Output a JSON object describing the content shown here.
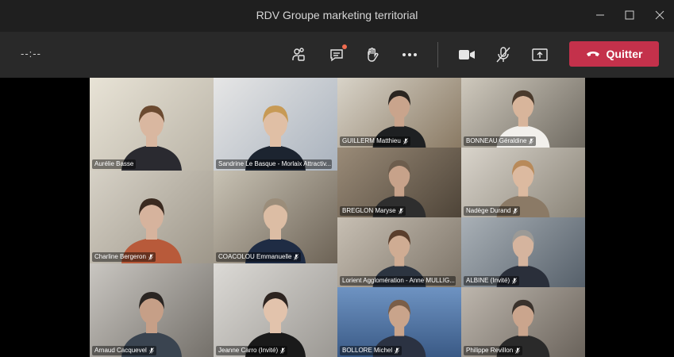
{
  "window": {
    "title": "RDV Groupe marketing territorial"
  },
  "toolbar": {
    "timer": "--:--",
    "leave_label": "Quitter",
    "icons": [
      "participants-icon",
      "chat-icon",
      "raise-hand-icon",
      "more-icon",
      "camera-icon",
      "mic-off-icon",
      "share-icon",
      "hangup-icon"
    ]
  },
  "colors": {
    "leave": "#c4314b",
    "toolbar": "#292929",
    "titlebar": "#1f1f1f",
    "badge": "#f06c50"
  },
  "participants": [
    {
      "name": "Aurélie Basse",
      "muted": false
    },
    {
      "name": "Sandrine Le Basque - Morlaix Attractiv...",
      "muted": true
    },
    {
      "name": "GUILLERM Matthieu",
      "muted": true
    },
    {
      "name": "BONNEAU Géraldine",
      "muted": true
    },
    {
      "name": "Charline Bergeron",
      "muted": true
    },
    {
      "name": "COACOLOU Emmanuelle",
      "muted": true
    },
    {
      "name": "BREGLON Maryse",
      "muted": true
    },
    {
      "name": "Nadège Durand",
      "muted": true
    },
    {
      "name": "Lorient Agglomération - Anne MULLIG...",
      "muted": true
    },
    {
      "name": "ALBINE (Invité)",
      "muted": true
    },
    {
      "name": "Arnaud Cacquevel",
      "muted": true
    },
    {
      "name": "Jeanne Carro (Invité)",
      "muted": true
    },
    {
      "name": "BOLLORE Michel",
      "muted": true
    },
    {
      "name": "Philippe Revillon",
      "muted": true
    }
  ]
}
